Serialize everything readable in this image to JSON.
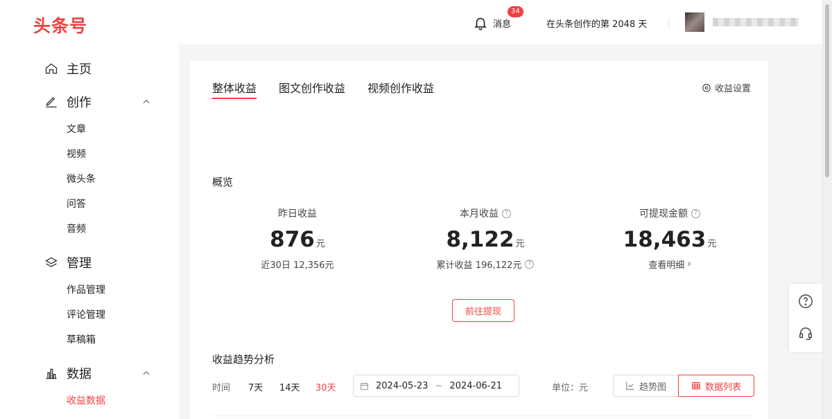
{
  "header": {
    "logo": "头条号",
    "messages_label": "消息",
    "messages_badge": "34",
    "days_text": "在头条创作的第 2048 天"
  },
  "sidebar": {
    "home": "主页",
    "create": "创作",
    "create_items": [
      "文章",
      "视频",
      "微头条",
      "问答",
      "音频"
    ],
    "manage": "管理",
    "manage_items": [
      "作品管理",
      "评论管理",
      "草稿箱"
    ],
    "data": "数据",
    "data_items": [
      "收益数据"
    ]
  },
  "tabs": [
    "整体收益",
    "图文创作收益",
    "视频创作收益"
  ],
  "settings_label": "收益设置",
  "overview": {
    "title": "概览",
    "stats": [
      {
        "label": "昨日收益",
        "value": "876",
        "unit": "元",
        "foot_label": "近30日",
        "foot_value": "12,356元"
      },
      {
        "label": "本月收益",
        "value": "8,122",
        "unit": "元",
        "foot_label": "累计收益",
        "foot_value": "196,122元"
      },
      {
        "label": "可提现金额",
        "value": "18,463",
        "unit": "元",
        "foot_label": "查看明细",
        "foot_value": "›"
      }
    ],
    "withdraw_button": "前往提现"
  },
  "trend": {
    "title": "收益趋势分析",
    "time_label": "时间",
    "ranges": [
      "7天",
      "14天",
      "30天"
    ],
    "active_range": "30天",
    "date_start": "2024-05-23",
    "date_sep": "~",
    "date_end": "2024-06-21",
    "unit_label": "单位：元",
    "view_chart": "趋势图",
    "view_table": "数据列表"
  },
  "colors": {
    "accent": "#f04142"
  }
}
